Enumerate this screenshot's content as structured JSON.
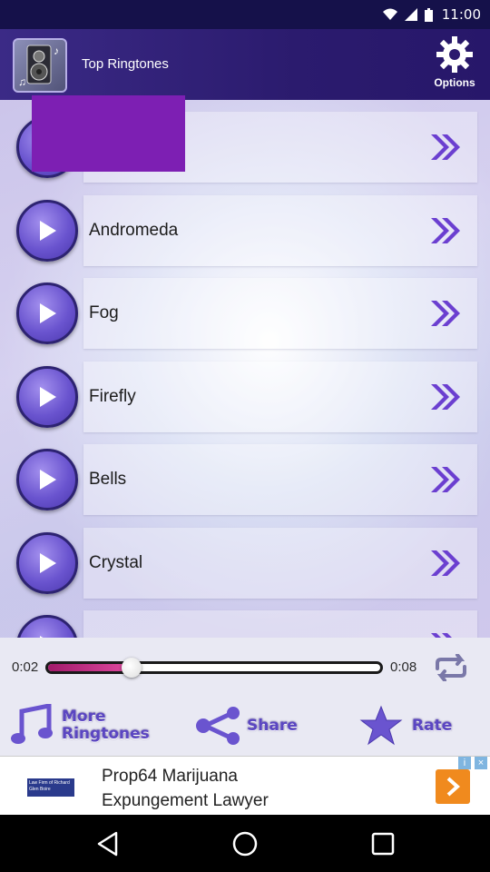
{
  "status": {
    "time": "11:00"
  },
  "header": {
    "title": "Top Ringtones",
    "options_label": "Options"
  },
  "ringtones": [
    {
      "name": ""
    },
    {
      "name": "Andromeda"
    },
    {
      "name": "Fog"
    },
    {
      "name": "Firefly"
    },
    {
      "name": "Bells"
    },
    {
      "name": "Crystal"
    },
    {
      "name": ""
    }
  ],
  "player": {
    "elapsed": "0:02",
    "total": "0:08",
    "progress_fraction": 0.25
  },
  "actions": {
    "more_line1": "More",
    "more_line2": "Ringtones",
    "share": "Share",
    "rate": "Rate"
  },
  "ad": {
    "line1": "Prop64 Marijuana",
    "line2": "Expungement Lawyer",
    "logo_text": "Law Firm of Richard Glen Boire"
  },
  "colors": {
    "header": "#2b1b6e",
    "accent": "#6a54cf",
    "arrow": "#6b3fd0",
    "popup": "#7d1fb3",
    "seek_fill": "#c0307f"
  }
}
